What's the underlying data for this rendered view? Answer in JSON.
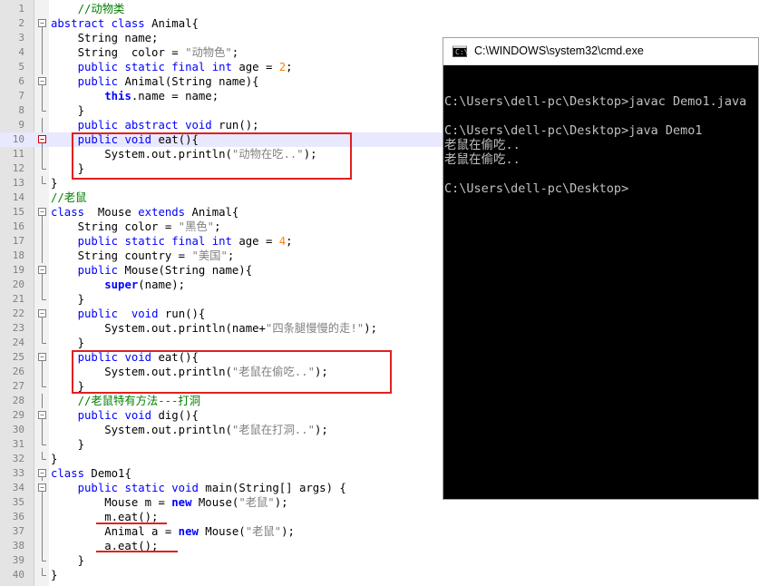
{
  "cmd": {
    "title": "C:\\WINDOWS\\system32\\cmd.exe",
    "lines": [
      "",
      "C:\\Users\\dell-pc\\Desktop>javac Demo1.java",
      "",
      "C:\\Users\\dell-pc\\Desktop>java Demo1",
      "老鼠在偷吃..",
      "老鼠在偷吃..",
      "",
      "C:\\Users\\dell-pc\\Desktop>"
    ]
  },
  "editor": {
    "current_line": 10,
    "lines": [
      {
        "n": "1",
        "fold": "",
        "tokens": [
          [
            "",
            "    "
          ],
          [
            "cm",
            "//动物类"
          ]
        ]
      },
      {
        "n": "2",
        "fold": "open",
        "tokens": [
          [
            "kw",
            "abstract"
          ],
          [
            "",
            " "
          ],
          [
            "kw",
            "class"
          ],
          [
            "",
            " Animal{"
          ]
        ]
      },
      {
        "n": "3",
        "fold": "bar",
        "tokens": [
          [
            "",
            "    String name;"
          ]
        ]
      },
      {
        "n": "4",
        "fold": "bar",
        "tokens": [
          [
            "",
            "    String  color = "
          ],
          [
            "str",
            "\"动物色\""
          ],
          [
            "",
            ";"
          ]
        ]
      },
      {
        "n": "5",
        "fold": "bar",
        "tokens": [
          [
            "",
            "    "
          ],
          [
            "kw",
            "public"
          ],
          [
            "",
            " "
          ],
          [
            "kw",
            "static"
          ],
          [
            "",
            " "
          ],
          [
            "kw",
            "final"
          ],
          [
            "",
            " "
          ],
          [
            "kw",
            "int"
          ],
          [
            "",
            " age = "
          ],
          [
            "num",
            "2"
          ],
          [
            "",
            ";"
          ]
        ]
      },
      {
        "n": "6",
        "fold": "open",
        "tokens": [
          [
            "",
            "    "
          ],
          [
            "kw",
            "public"
          ],
          [
            "",
            " Animal(String name){"
          ]
        ]
      },
      {
        "n": "7",
        "fold": "bar",
        "tokens": [
          [
            "",
            "        "
          ],
          [
            "kw2",
            "this"
          ],
          [
            "",
            ".name = name;"
          ]
        ]
      },
      {
        "n": "8",
        "fold": "end",
        "tokens": [
          [
            "",
            "    }"
          ]
        ]
      },
      {
        "n": "9",
        "fold": "bar",
        "tokens": [
          [
            "",
            "    "
          ],
          [
            "kw",
            "public"
          ],
          [
            "",
            " "
          ],
          [
            "kw",
            "abstract"
          ],
          [
            "",
            " "
          ],
          [
            "kw",
            "void"
          ],
          [
            "",
            " run();"
          ]
        ]
      },
      {
        "n": "10",
        "fold": "open",
        "tokens": [
          [
            "",
            "    "
          ],
          [
            "kw",
            "public"
          ],
          [
            "",
            " "
          ],
          [
            "kw",
            "void"
          ],
          [
            "",
            " eat(){"
          ]
        ]
      },
      {
        "n": "11",
        "fold": "bar",
        "tokens": [
          [
            "",
            "        System.out.println("
          ],
          [
            "str",
            "\"动物在吃..\""
          ],
          [
            "",
            ");"
          ]
        ]
      },
      {
        "n": "12",
        "fold": "end",
        "tokens": [
          [
            "",
            "    }"
          ]
        ]
      },
      {
        "n": "13",
        "fold": "end",
        "tokens": [
          [
            "",
            "}"
          ]
        ]
      },
      {
        "n": "14",
        "fold": "",
        "tokens": [
          [
            "cm",
            "//老鼠"
          ]
        ]
      },
      {
        "n": "15",
        "fold": "open",
        "tokens": [
          [
            "kw",
            "class"
          ],
          [
            "",
            "  Mouse "
          ],
          [
            "kw",
            "extends"
          ],
          [
            "",
            " Animal{"
          ]
        ]
      },
      {
        "n": "16",
        "fold": "bar",
        "tokens": [
          [
            "",
            "    String color = "
          ],
          [
            "str",
            "\"黑色\""
          ],
          [
            "",
            ";"
          ]
        ]
      },
      {
        "n": "17",
        "fold": "bar",
        "tokens": [
          [
            "",
            "    "
          ],
          [
            "kw",
            "public"
          ],
          [
            "",
            " "
          ],
          [
            "kw",
            "static"
          ],
          [
            "",
            " "
          ],
          [
            "kw",
            "final"
          ],
          [
            "",
            " "
          ],
          [
            "kw",
            "int"
          ],
          [
            "",
            " age = "
          ],
          [
            "num",
            "4"
          ],
          [
            "",
            ";"
          ]
        ]
      },
      {
        "n": "18",
        "fold": "bar",
        "tokens": [
          [
            "",
            "    String country = "
          ],
          [
            "str",
            "\"美国\""
          ],
          [
            "",
            ";"
          ]
        ]
      },
      {
        "n": "19",
        "fold": "open",
        "tokens": [
          [
            "",
            "    "
          ],
          [
            "kw",
            "public"
          ],
          [
            "",
            " Mouse(String name){"
          ]
        ]
      },
      {
        "n": "20",
        "fold": "bar",
        "tokens": [
          [
            "",
            "        "
          ],
          [
            "kw2",
            "super"
          ],
          [
            "",
            "(name);"
          ]
        ]
      },
      {
        "n": "21",
        "fold": "end",
        "tokens": [
          [
            "",
            "    }"
          ]
        ]
      },
      {
        "n": "22",
        "fold": "open",
        "tokens": [
          [
            "",
            "    "
          ],
          [
            "kw",
            "public"
          ],
          [
            "",
            "  "
          ],
          [
            "kw",
            "void"
          ],
          [
            "",
            " run(){"
          ]
        ]
      },
      {
        "n": "23",
        "fold": "bar",
        "tokens": [
          [
            "",
            "        System.out.println(name+"
          ],
          [
            "str",
            "\"四条腿慢慢的走!\""
          ],
          [
            "",
            ");"
          ]
        ]
      },
      {
        "n": "24",
        "fold": "end",
        "tokens": [
          [
            "",
            "    }"
          ]
        ]
      },
      {
        "n": "25",
        "fold": "open",
        "tokens": [
          [
            "",
            "    "
          ],
          [
            "kw",
            "public"
          ],
          [
            "",
            " "
          ],
          [
            "kw",
            "void"
          ],
          [
            "",
            " eat(){"
          ]
        ]
      },
      {
        "n": "26",
        "fold": "bar",
        "tokens": [
          [
            "",
            "        System.out.println("
          ],
          [
            "str",
            "\"老鼠在偷吃..\""
          ],
          [
            "",
            ");"
          ]
        ]
      },
      {
        "n": "27",
        "fold": "end",
        "tokens": [
          [
            "",
            "    }"
          ]
        ]
      },
      {
        "n": "28",
        "fold": "bar",
        "tokens": [
          [
            "",
            "    "
          ],
          [
            "cm",
            "//老鼠特有方法---打洞"
          ]
        ]
      },
      {
        "n": "29",
        "fold": "open",
        "tokens": [
          [
            "",
            "    "
          ],
          [
            "kw",
            "public"
          ],
          [
            "",
            " "
          ],
          [
            "kw",
            "void"
          ],
          [
            "",
            " dig(){"
          ]
        ]
      },
      {
        "n": "30",
        "fold": "bar",
        "tokens": [
          [
            "",
            "        System.out.println("
          ],
          [
            "str",
            "\"老鼠在打洞..\""
          ],
          [
            "",
            ");"
          ]
        ]
      },
      {
        "n": "31",
        "fold": "end",
        "tokens": [
          [
            "",
            "    }"
          ]
        ]
      },
      {
        "n": "32",
        "fold": "end",
        "tokens": [
          [
            "",
            "}"
          ]
        ]
      },
      {
        "n": "33",
        "fold": "open",
        "tokens": [
          [
            "kw",
            "class"
          ],
          [
            "",
            " Demo1{"
          ]
        ]
      },
      {
        "n": "34",
        "fold": "open",
        "tokens": [
          [
            "",
            "    "
          ],
          [
            "kw",
            "public"
          ],
          [
            "",
            " "
          ],
          [
            "kw",
            "static"
          ],
          [
            "",
            " "
          ],
          [
            "kw",
            "void"
          ],
          [
            "",
            " main(String[] args) {"
          ]
        ]
      },
      {
        "n": "35",
        "fold": "bar",
        "tokens": [
          [
            "",
            "        Mouse m = "
          ],
          [
            "kw2",
            "new"
          ],
          [
            "",
            " Mouse("
          ],
          [
            "str",
            "\"老鼠\""
          ],
          [
            "",
            ");"
          ]
        ]
      },
      {
        "n": "36",
        "fold": "bar",
        "tokens": [
          [
            "",
            "        m.eat();"
          ]
        ]
      },
      {
        "n": "37",
        "fold": "bar",
        "tokens": [
          [
            "",
            "        Animal a = "
          ],
          [
            "kw2",
            "new"
          ],
          [
            "",
            " Mouse("
          ],
          [
            "str",
            "\"老鼠\""
          ],
          [
            "",
            ");"
          ]
        ]
      },
      {
        "n": "38",
        "fold": "bar",
        "tokens": [
          [
            "",
            "        a.eat();"
          ]
        ]
      },
      {
        "n": "39",
        "fold": "end",
        "tokens": [
          [
            "",
            "    }"
          ]
        ]
      },
      {
        "n": "40",
        "fold": "end",
        "tokens": [
          [
            "",
            "}"
          ]
        ]
      }
    ]
  }
}
